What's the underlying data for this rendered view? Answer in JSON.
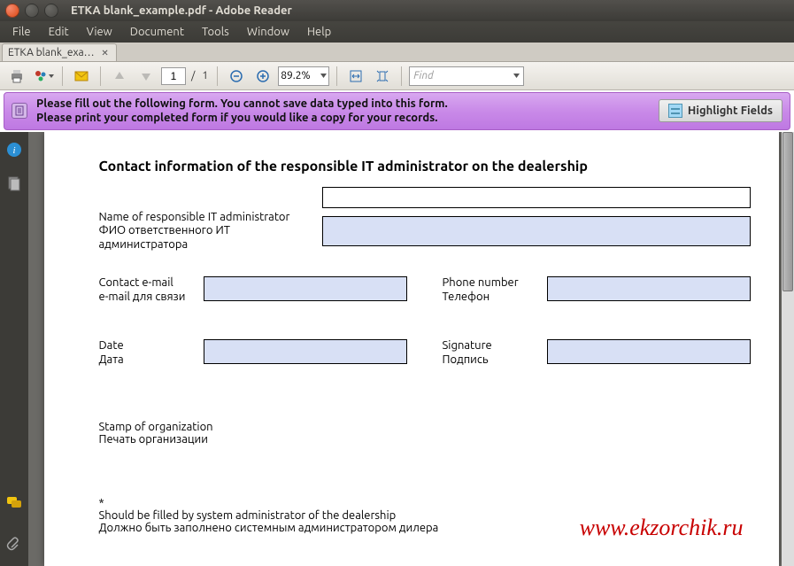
{
  "window": {
    "title": "ETKA blank_example.pdf - Adobe Reader"
  },
  "menu": {
    "items": [
      "File",
      "Edit",
      "View",
      "Document",
      "Tools",
      "Window",
      "Help"
    ]
  },
  "tabs": {
    "items": [
      {
        "label": "ETKA blank_exa…"
      }
    ]
  },
  "toolbar": {
    "page_current": "1",
    "page_sep": "/",
    "page_total": "1",
    "zoom": "89.2%",
    "find_placeholder": "Find"
  },
  "notify": {
    "line1": "Please fill out the following form. You cannot save data typed into this form.",
    "line2": "Please print your completed form if you would like a copy for your records.",
    "highlight_label": "Highlight Fields"
  },
  "doc": {
    "heading": "Contact information of the responsible IT administrator on the dealership",
    "name_label_en": "Name of responsible IT administrator",
    "name_label_ru": "ФИО ответственного ИТ администратора",
    "email_label_en": "Contact e-mail",
    "email_label_ru": "e-mail для связи",
    "phone_label_en": "Phone number",
    "phone_label_ru": "Телефон",
    "date_label_en": "Date",
    "date_label_ru": "Дата",
    "sig_label_en": "Signature",
    "sig_label_ru": "Подпись",
    "stamp_en": "Stamp of organization",
    "stamp_ru": "Печать организации",
    "asterisk": "*",
    "footnote_en": "Should be filled by system administrator of the dealership",
    "footnote_ru": "Должно быть заполнено системным администратором дилера",
    "watermark": "www.ekzorchik.ru"
  }
}
